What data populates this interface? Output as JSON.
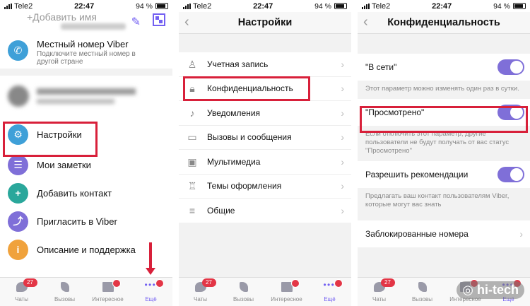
{
  "status": {
    "carrier": "Tele2",
    "time": "22:47",
    "battery": "94 %"
  },
  "screen1": {
    "add_name": "+Добавить имя",
    "local_number": {
      "title": "Местный номер Viber",
      "subtitle": "Подключите местный номер в другой стране"
    },
    "menu": [
      {
        "label": "Настройки",
        "color": "#3fa0d8",
        "icon": "gear-icon"
      },
      {
        "label": "Мои заметки",
        "color": "#7f6fd8",
        "icon": "notes-icon"
      },
      {
        "label": "Добавить контакт",
        "color": "#2aa79b",
        "icon": "add-contact-icon"
      },
      {
        "label": "Пригласить в Viber",
        "color": "#7f6fd8",
        "icon": "share-icon"
      },
      {
        "label": "Описание и поддержка",
        "color": "#f0a23c",
        "icon": "info-icon"
      }
    ]
  },
  "screen2": {
    "title": "Настройки",
    "items": [
      {
        "label": "Учетная запись",
        "icon": "account-icon"
      },
      {
        "label": "Конфиденциальность",
        "icon": "lock-icon"
      },
      {
        "label": "Уведомления",
        "icon": "bell-icon"
      },
      {
        "label": "Вызовы и сообщения",
        "icon": "chat-icon"
      },
      {
        "label": "Мультимедиа",
        "icon": "media-icon"
      },
      {
        "label": "Темы оформления",
        "icon": "brush-icon"
      },
      {
        "label": "Общие",
        "icon": "list-icon"
      }
    ]
  },
  "screen3": {
    "title": "Конфиденциальность",
    "online_label": "\"В сети\"",
    "online_note": "Этот параметр можно изменять один раз в сутки.",
    "seen_label": "\"Просмотрено\"",
    "seen_note": "Если отключить этот параметр, другие пользователи не будут получать от вас статус \"Просмотрено\"",
    "recommend_label": "Разрешить рекомендации",
    "recommend_note": "Предлагать ваш контакт пользователям Viber, которые могут вас знать",
    "blocked_label": "Заблокированные номера"
  },
  "tabbar": {
    "chats": "Чаты",
    "calls": "Вызовы",
    "explore": "Интересное",
    "more": "Ещё",
    "chats_badge": "27"
  },
  "watermark": "hi-tech",
  "accent": "#7360f2",
  "highlight": "#d8203a"
}
